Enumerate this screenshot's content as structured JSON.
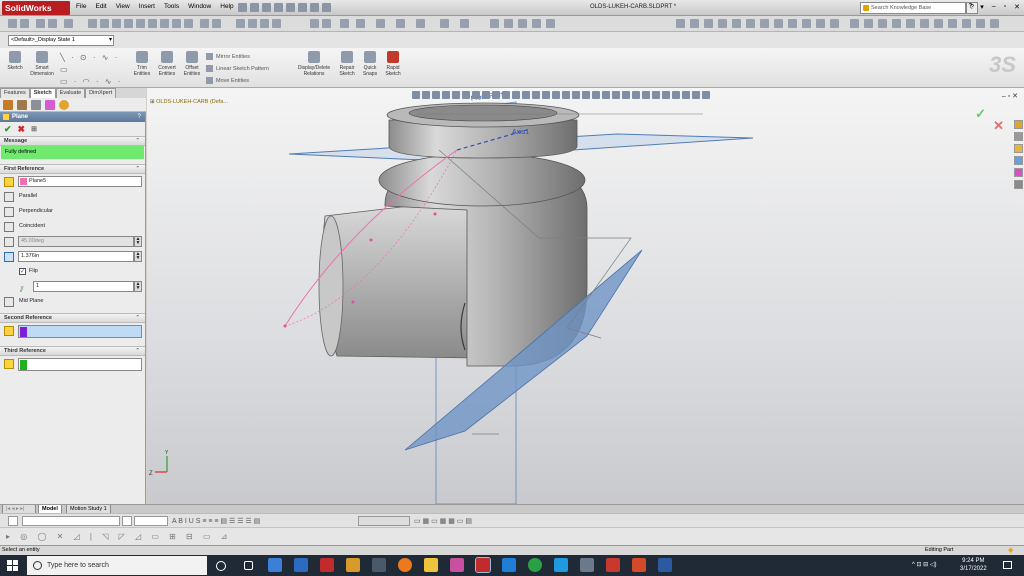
{
  "app": {
    "name": "SolidWorks",
    "menu": [
      "File",
      "Edit",
      "View",
      "Insert",
      "Tools",
      "Window",
      "Help"
    ],
    "document_title": "OLDS-LUKEH-CARB.SLDPRT *",
    "search_placeholder": "Search Knowledge Base",
    "search_button": "?",
    "window_controls": [
      "?",
      "▾",
      "–",
      "▫",
      "✕"
    ]
  },
  "config": {
    "display_state": "<Default>_Display State 1"
  },
  "command_manager": {
    "sketch": "Sketch",
    "smart_dimension_1": "Smart",
    "smart_dimension_2": "Dimension",
    "trim_1": "Trim",
    "trim_2": "Entities",
    "convert_1": "Convert",
    "convert_2": "Entities",
    "offset_1": "Offset",
    "offset_2": "Entities",
    "mirror": "Mirror Entities",
    "linear_pattern": "Linear Sketch Pattern",
    "move": "Move Entities",
    "display_delete_1": "Display/Delete",
    "display_delete_2": "Relations",
    "repair_1": "Repair",
    "repair_2": "Sketch",
    "quick_snaps_1": "Quick",
    "quick_snaps_2": "Snaps",
    "rapid_1": "Rapid",
    "rapid_2": "Sketch"
  },
  "tabs": [
    "Features",
    "Sketch",
    "Evaluate",
    "DimXpert"
  ],
  "property_manager": {
    "title": "Plane",
    "help": "?",
    "message_header": "Message",
    "message": "Fully defined",
    "first_reference_header": "First Reference",
    "first_reference_value": "Plane5",
    "parallel": "Parallel",
    "perpendicular": "Perpendicular",
    "coincident": "Coincident",
    "angle": "45.00deg",
    "distance": "1.376in",
    "flip": "Flip",
    "instances": "1",
    "mid_plane": "Mid Plane",
    "second_reference_header": "Second Reference",
    "third_reference_header": "Third Reference",
    "colors": {
      "first": "#f06fb1",
      "second": "#7a1fd6",
      "third": "#20b020"
    }
  },
  "graphics": {
    "tree_root": "OLDS-LUKEH-CARB",
    "tree_root_suffix": "(Defa...",
    "front_plane_label": "Front Plane",
    "axis_label": "Axis1",
    "ok_mark": "✓",
    "cancel_mark": "✕",
    "window_controls": "– ▫ ✕"
  },
  "bottom": {
    "model_tab": "Model",
    "motion_tab": "Motion Study 1",
    "status_left": "Select an entity",
    "status_right": "Editing Part"
  },
  "taskbar": {
    "search_placeholder": "Type here to search",
    "time": "9:24 PM",
    "date": "3/17/2022"
  },
  "colors": {
    "accent": "#b81d22",
    "message_ok": "#6fea6f",
    "plane_blue": "#4f7db6"
  }
}
